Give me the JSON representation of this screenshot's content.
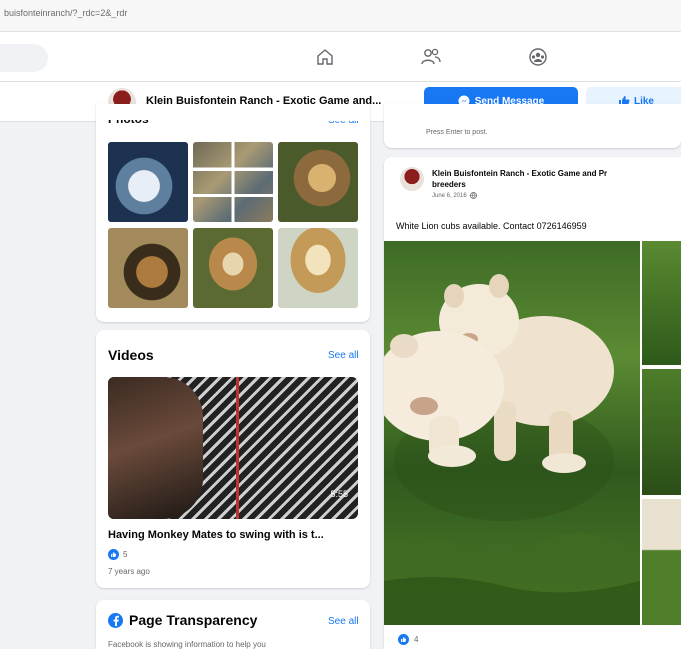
{
  "browser": {
    "url": "buisfonteinranch/?_rdc=2&_rdr"
  },
  "topnav": {
    "icons": [
      "home-icon",
      "friends-icon",
      "groups-icon"
    ]
  },
  "page": {
    "name": "Klein Buisfontein Ranch - Exotic Game and...",
    "send_message": "Send Message",
    "like": "Like"
  },
  "photos": {
    "title": "Photos",
    "see_all": "See all"
  },
  "videos": {
    "title": "Videos",
    "see_all": "See all",
    "duration": "5:55",
    "caption": "Having Monkey Mates to swing with is t...",
    "reactions": "5",
    "age": "7 years ago"
  },
  "transparency": {
    "title": "Page Transparency",
    "see_all": "See all",
    "text": "Facebook is showing information to help you"
  },
  "composer": {
    "hint": "Press Enter to post."
  },
  "post": {
    "author_line1": "Klein Buisfontein Ranch - Exotic Game and Pr",
    "author_line2": "breeders",
    "date": "June 6, 2016 · ",
    "text": "White Lion cubs available. Contact 0726146959",
    "reactions": "4"
  },
  "colors": {
    "accent": "#1877f2",
    "bg": "#f0f2f5",
    "card": "#ffffff"
  }
}
